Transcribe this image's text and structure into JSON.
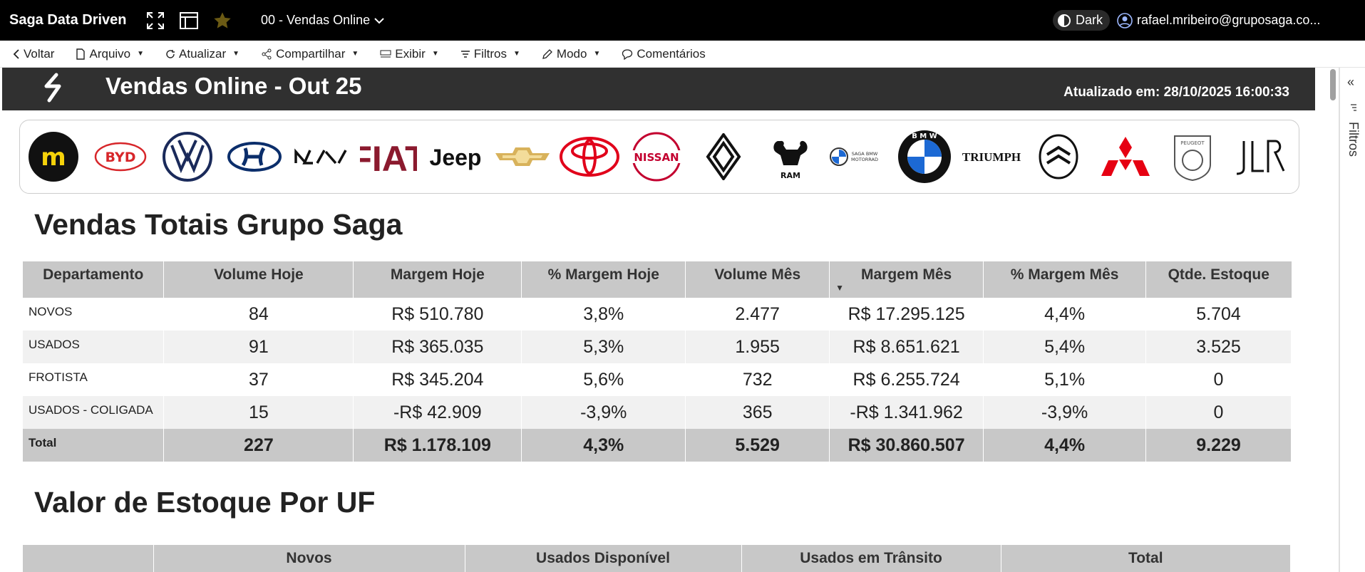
{
  "app": {
    "title": "Saga Data Driven",
    "report_name": "00 - Vendas Online",
    "theme_label": "Dark",
    "user_email": "rafael.mribeiro@gruposaga.co..."
  },
  "menu": {
    "back": "Voltar",
    "file": "Arquivo",
    "refresh": "Atualizar",
    "share": "Compartilhar",
    "view": "Exibir",
    "filters": "Filtros",
    "mode": "Modo",
    "comments": "Comentários"
  },
  "report": {
    "title": "Vendas Online - Out 25",
    "updated_label": "Atualizado em:",
    "updated_value": "28/10/2025 16:00:33"
  },
  "brands": [
    "m",
    "BYD",
    "Volkswagen",
    "Hyundai",
    "Kia",
    "FIAT",
    "Jeep",
    "Chevrolet",
    "Toyota",
    "NISSAN",
    "Renault",
    "RAM",
    "SAGA BMW MOTORRAD",
    "BMW",
    "TRIUMPH",
    "Citroën",
    "Mitsubishi",
    "PEUGEOT",
    "JLR"
  ],
  "sales": {
    "title": "Vendas Totais Grupo Saga",
    "columns": [
      "Departamento",
      "Volume Hoje",
      "Margem Hoje",
      "% Margem Hoje",
      "Volume Mês",
      "Margem Mês",
      "% Margem Mês",
      "Qtde. Estoque"
    ],
    "sorted_column": "Margem Mês",
    "rows": [
      [
        "NOVOS",
        "84",
        "R$ 510.780",
        "3,8%",
        "2.477",
        "R$ 17.295.125",
        "4,4%",
        "5.704"
      ],
      [
        "USADOS",
        "91",
        "R$ 365.035",
        "5,3%",
        "1.955",
        "R$ 8.651.621",
        "5,4%",
        "3.525"
      ],
      [
        "FROTISTA",
        "37",
        "R$ 345.204",
        "5,6%",
        "732",
        "R$ 6.255.724",
        "5,1%",
        "0"
      ],
      [
        "USADOS - COLIGADA",
        "15",
        "-R$ 42.909",
        "-3,9%",
        "365",
        "-R$ 1.341.962",
        "-3,9%",
        "0"
      ]
    ],
    "total": [
      "Total",
      "227",
      "R$ 1.178.109",
      "4,3%",
      "5.529",
      "R$ 30.860.507",
      "4,4%",
      "9.229"
    ]
  },
  "stock": {
    "title": "Valor de Estoque Por UF",
    "columns": [
      "",
      "Novos",
      "Usados Disponível",
      "Usados em Trânsito",
      "Total"
    ]
  },
  "filter_pane": {
    "label": "Filtros",
    "collapse": "«"
  },
  "colors": {
    "topbar": "#000000",
    "header_band": "#303030",
    "table_header": "#c8c8c8",
    "table_stripe": "#f1f1f1"
  }
}
